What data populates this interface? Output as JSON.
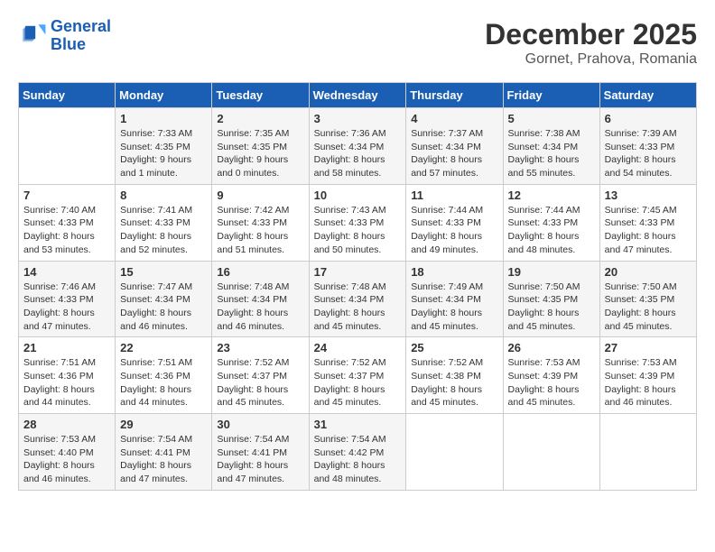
{
  "logo": {
    "line1": "General",
    "line2": "Blue"
  },
  "title": "December 2025",
  "subtitle": "Gornet, Prahova, Romania",
  "days_header": [
    "Sunday",
    "Monday",
    "Tuesday",
    "Wednesday",
    "Thursday",
    "Friday",
    "Saturday"
  ],
  "weeks": [
    [
      {
        "day": "",
        "info": ""
      },
      {
        "day": "1",
        "info": "Sunrise: 7:33 AM\nSunset: 4:35 PM\nDaylight: 9 hours\nand 1 minute."
      },
      {
        "day": "2",
        "info": "Sunrise: 7:35 AM\nSunset: 4:35 PM\nDaylight: 9 hours\nand 0 minutes."
      },
      {
        "day": "3",
        "info": "Sunrise: 7:36 AM\nSunset: 4:34 PM\nDaylight: 8 hours\nand 58 minutes."
      },
      {
        "day": "4",
        "info": "Sunrise: 7:37 AM\nSunset: 4:34 PM\nDaylight: 8 hours\nand 57 minutes."
      },
      {
        "day": "5",
        "info": "Sunrise: 7:38 AM\nSunset: 4:34 PM\nDaylight: 8 hours\nand 55 minutes."
      },
      {
        "day": "6",
        "info": "Sunrise: 7:39 AM\nSunset: 4:33 PM\nDaylight: 8 hours\nand 54 minutes."
      }
    ],
    [
      {
        "day": "7",
        "info": "Sunrise: 7:40 AM\nSunset: 4:33 PM\nDaylight: 8 hours\nand 53 minutes."
      },
      {
        "day": "8",
        "info": "Sunrise: 7:41 AM\nSunset: 4:33 PM\nDaylight: 8 hours\nand 52 minutes."
      },
      {
        "day": "9",
        "info": "Sunrise: 7:42 AM\nSunset: 4:33 PM\nDaylight: 8 hours\nand 51 minutes."
      },
      {
        "day": "10",
        "info": "Sunrise: 7:43 AM\nSunset: 4:33 PM\nDaylight: 8 hours\nand 50 minutes."
      },
      {
        "day": "11",
        "info": "Sunrise: 7:44 AM\nSunset: 4:33 PM\nDaylight: 8 hours\nand 49 minutes."
      },
      {
        "day": "12",
        "info": "Sunrise: 7:44 AM\nSunset: 4:33 PM\nDaylight: 8 hours\nand 48 minutes."
      },
      {
        "day": "13",
        "info": "Sunrise: 7:45 AM\nSunset: 4:33 PM\nDaylight: 8 hours\nand 47 minutes."
      }
    ],
    [
      {
        "day": "14",
        "info": "Sunrise: 7:46 AM\nSunset: 4:33 PM\nDaylight: 8 hours\nand 47 minutes."
      },
      {
        "day": "15",
        "info": "Sunrise: 7:47 AM\nSunset: 4:34 PM\nDaylight: 8 hours\nand 46 minutes."
      },
      {
        "day": "16",
        "info": "Sunrise: 7:48 AM\nSunset: 4:34 PM\nDaylight: 8 hours\nand 46 minutes."
      },
      {
        "day": "17",
        "info": "Sunrise: 7:48 AM\nSunset: 4:34 PM\nDaylight: 8 hours\nand 45 minutes."
      },
      {
        "day": "18",
        "info": "Sunrise: 7:49 AM\nSunset: 4:34 PM\nDaylight: 8 hours\nand 45 minutes."
      },
      {
        "day": "19",
        "info": "Sunrise: 7:50 AM\nSunset: 4:35 PM\nDaylight: 8 hours\nand 45 minutes."
      },
      {
        "day": "20",
        "info": "Sunrise: 7:50 AM\nSunset: 4:35 PM\nDaylight: 8 hours\nand 45 minutes."
      }
    ],
    [
      {
        "day": "21",
        "info": "Sunrise: 7:51 AM\nSunset: 4:36 PM\nDaylight: 8 hours\nand 44 minutes."
      },
      {
        "day": "22",
        "info": "Sunrise: 7:51 AM\nSunset: 4:36 PM\nDaylight: 8 hours\nand 44 minutes."
      },
      {
        "day": "23",
        "info": "Sunrise: 7:52 AM\nSunset: 4:37 PM\nDaylight: 8 hours\nand 45 minutes."
      },
      {
        "day": "24",
        "info": "Sunrise: 7:52 AM\nSunset: 4:37 PM\nDaylight: 8 hours\nand 45 minutes."
      },
      {
        "day": "25",
        "info": "Sunrise: 7:52 AM\nSunset: 4:38 PM\nDaylight: 8 hours\nand 45 minutes."
      },
      {
        "day": "26",
        "info": "Sunrise: 7:53 AM\nSunset: 4:39 PM\nDaylight: 8 hours\nand 45 minutes."
      },
      {
        "day": "27",
        "info": "Sunrise: 7:53 AM\nSunset: 4:39 PM\nDaylight: 8 hours\nand 46 minutes."
      }
    ],
    [
      {
        "day": "28",
        "info": "Sunrise: 7:53 AM\nSunset: 4:40 PM\nDaylight: 8 hours\nand 46 minutes."
      },
      {
        "day": "29",
        "info": "Sunrise: 7:54 AM\nSunset: 4:41 PM\nDaylight: 8 hours\nand 47 minutes."
      },
      {
        "day": "30",
        "info": "Sunrise: 7:54 AM\nSunset: 4:41 PM\nDaylight: 8 hours\nand 47 minutes."
      },
      {
        "day": "31",
        "info": "Sunrise: 7:54 AM\nSunset: 4:42 PM\nDaylight: 8 hours\nand 48 minutes."
      },
      {
        "day": "",
        "info": ""
      },
      {
        "day": "",
        "info": ""
      },
      {
        "day": "",
        "info": ""
      }
    ]
  ]
}
